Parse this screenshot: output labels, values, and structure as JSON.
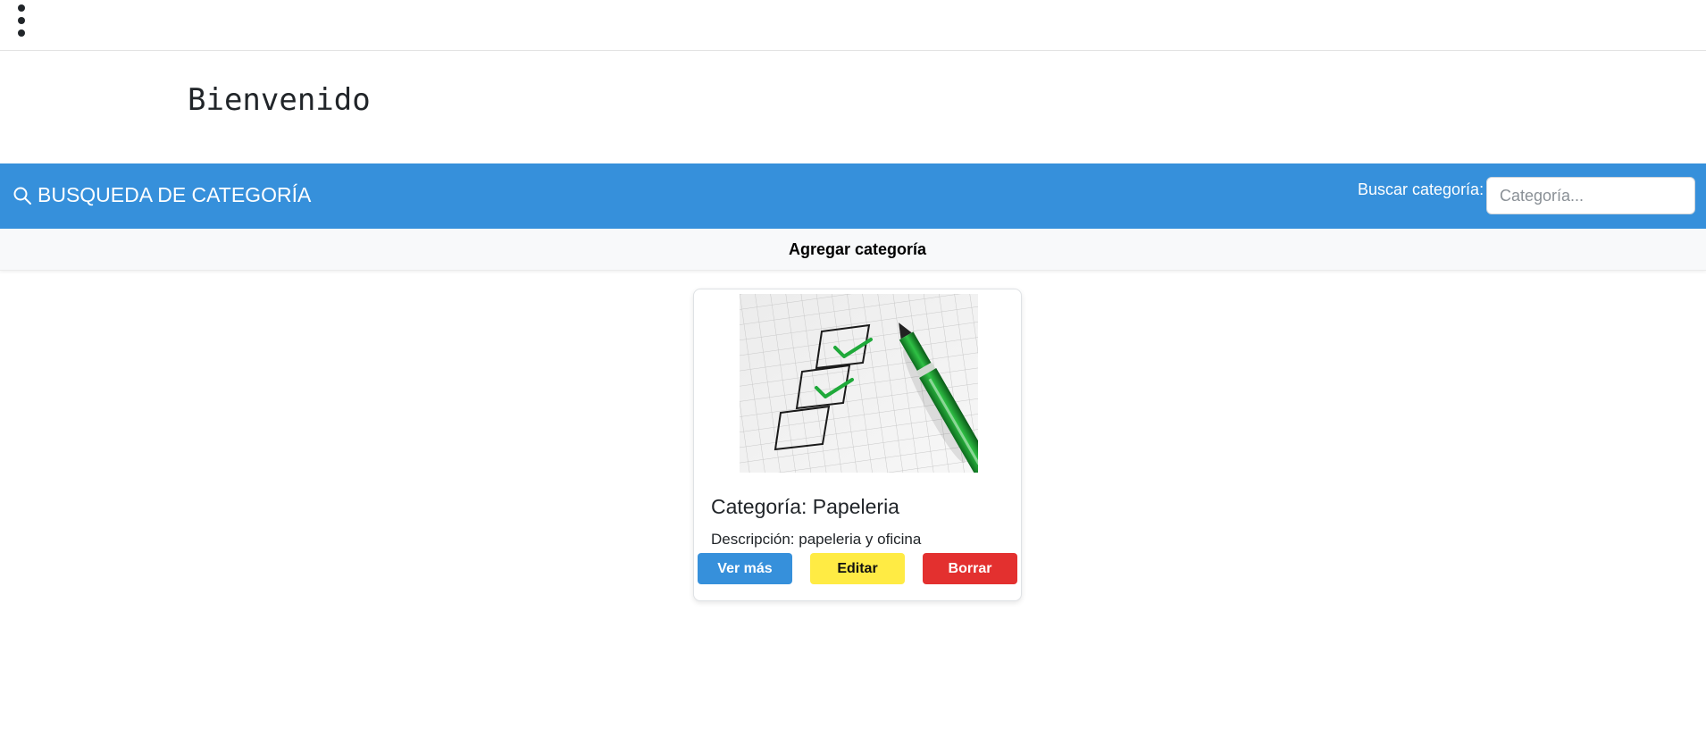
{
  "menu": {
    "icon": "kebab-menu-icon"
  },
  "header": {
    "welcome": "Bienvenido"
  },
  "search": {
    "icon": "search-icon",
    "title": "BUSQUEDA DE CATEGORÍA",
    "label": "Buscar categoría:",
    "placeholder": "Categoría...",
    "value": ""
  },
  "actions": {
    "add_label": "Agregar categoría"
  },
  "cards": [
    {
      "title": "Categoría: Papeleria",
      "description": "Descripción: papeleria y oficina",
      "buttons": {
        "view": "Ver más",
        "edit": "Editar",
        "delete": "Borrar"
      }
    }
  ],
  "colors": {
    "primary": "#3690db",
    "warning": "#ffeb44",
    "danger": "#e3302f",
    "light": "#f8f9fa"
  }
}
